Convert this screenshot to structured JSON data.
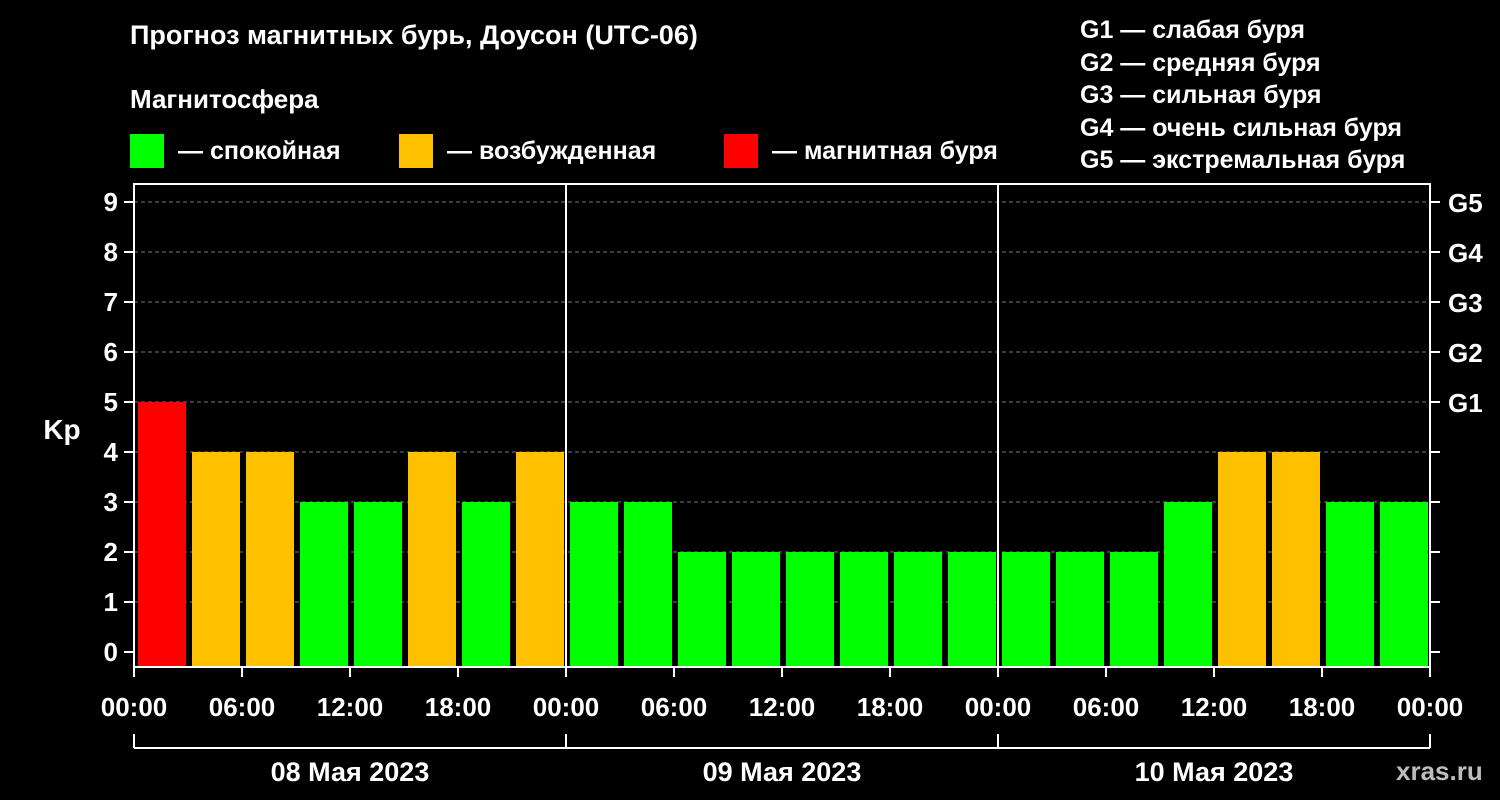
{
  "header": {
    "title": "Прогноз магнитных бурь, Доусон (UTC-06)",
    "subtitle": "Магнитосфера"
  },
  "legend": [
    {
      "label": "— спокойная",
      "color": "#00ff00"
    },
    {
      "label": "— возбужденная",
      "color": "#ffc000"
    },
    {
      "label": "— магнитная буря",
      "color": "#ff0000"
    }
  ],
  "storm_scale": [
    "G1 — слабая буря",
    "G2 — средняя буря",
    "G3 — сильная буря",
    "G4 — очень сильная буря",
    "G5 — экстремальная буря"
  ],
  "watermark": "xras.ru",
  "chart_data": {
    "type": "bar",
    "ylabel": "Kp",
    "ylim": [
      0,
      9
    ],
    "yticks": [
      "0",
      "1",
      "2",
      "3",
      "4",
      "5",
      "6",
      "7",
      "8",
      "9"
    ],
    "right_ticks": [
      {
        "value": 5,
        "label": "G1"
      },
      {
        "value": 6,
        "label": "G2"
      },
      {
        "value": 7,
        "label": "G3"
      },
      {
        "value": 8,
        "label": "G4"
      },
      {
        "value": 9,
        "label": "G5"
      }
    ],
    "xtick_labels": [
      "00:00",
      "06:00",
      "12:00",
      "18:00",
      "00:00",
      "06:00",
      "12:00",
      "18:00",
      "00:00",
      "06:00",
      "12:00",
      "18:00",
      "00:00"
    ],
    "days": [
      "08 Мая 2023",
      "09 Мая 2023",
      "10 Мая 2023"
    ],
    "values": [
      5,
      4,
      4,
      3,
      3,
      4,
      3,
      4,
      3,
      3,
      2,
      2,
      2,
      2,
      2,
      2,
      2,
      2,
      2,
      3,
      4,
      4,
      3,
      3
    ],
    "colors": {
      "quiet": "#00ff00",
      "active": "#ffc000",
      "storm": "#ff0000"
    },
    "grid": true
  }
}
